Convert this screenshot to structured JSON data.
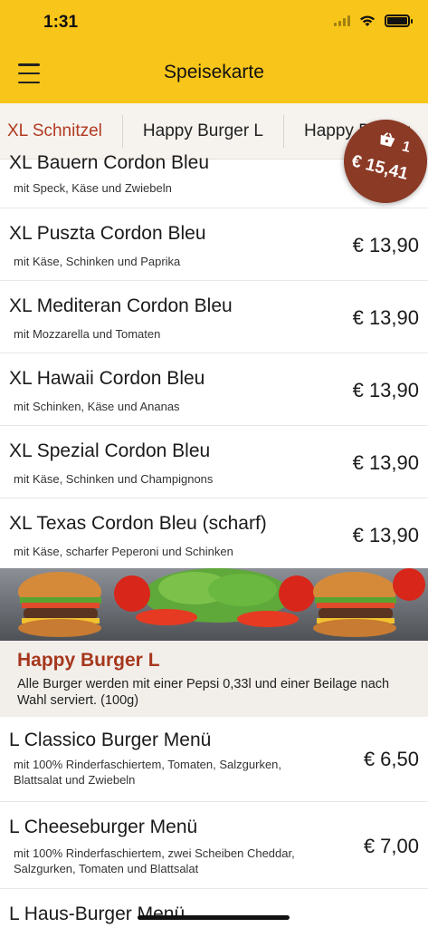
{
  "status": {
    "time": "1:31"
  },
  "header": {
    "title": "Speisekarte"
  },
  "tabs": [
    {
      "label": "XL Schnitzel",
      "active": true
    },
    {
      "label": "Happy Burger L",
      "active": false
    },
    {
      "label": "Happy Burger",
      "active": false
    }
  ],
  "cart": {
    "count": "1",
    "total": "€ 15,41"
  },
  "items_top": [
    {
      "name": "XL Bauern Cordon Bleu",
      "desc": "mit Speck, Käse und Zwiebeln",
      "price": ""
    },
    {
      "name": "XL Puszta Cordon Bleu",
      "desc": "mit Käse, Schinken und Paprika",
      "price": "€ 13,90"
    },
    {
      "name": "XL Mediteran Cordon Bleu",
      "desc": "mit Mozzarella und Tomaten",
      "price": "€ 13,90"
    },
    {
      "name": "XL Hawaii Cordon Bleu",
      "desc": "mit Schinken, Käse und Ananas",
      "price": "€ 13,90"
    },
    {
      "name": "XL Spezial Cordon Bleu",
      "desc": "mit Käse, Schinken und Champignons",
      "price": "€ 13,90"
    },
    {
      "name": "XL Texas Cordon Bleu (scharf)",
      "desc": "mit Käse, scharfer Peperoni und Schinken",
      "price": "€ 13,90"
    }
  ],
  "section": {
    "title": "Happy Burger L",
    "desc": "Alle Burger werden mit einer Pepsi 0,33l und einer Beilage nach Wahl serviert. (100g)"
  },
  "items_burger": [
    {
      "name": "L Classico Burger Menü",
      "desc": "mit 100% Rinderfaschiertem, Tomaten, Salzgurken, Blattsalat und Zwiebeln",
      "price": "€ 6,50"
    },
    {
      "name": "L Cheeseburger Menü",
      "desc": "mit 100% Rinderfaschiertem, zwei Scheiben Cheddar, Salzgurken, Tomaten und Blattsalat",
      "price": "€ 7,00"
    },
    {
      "name": "L Haus-Burger Menü",
      "desc": "",
      "price": ""
    }
  ],
  "colors": {
    "header": "#f8c51a",
    "accent": "#a6371d",
    "cart": "#8b3a26"
  },
  "icons": [
    "menu-icon",
    "wifi-icon",
    "signal-icon",
    "battery-icon",
    "shopping-bag-icon"
  ]
}
